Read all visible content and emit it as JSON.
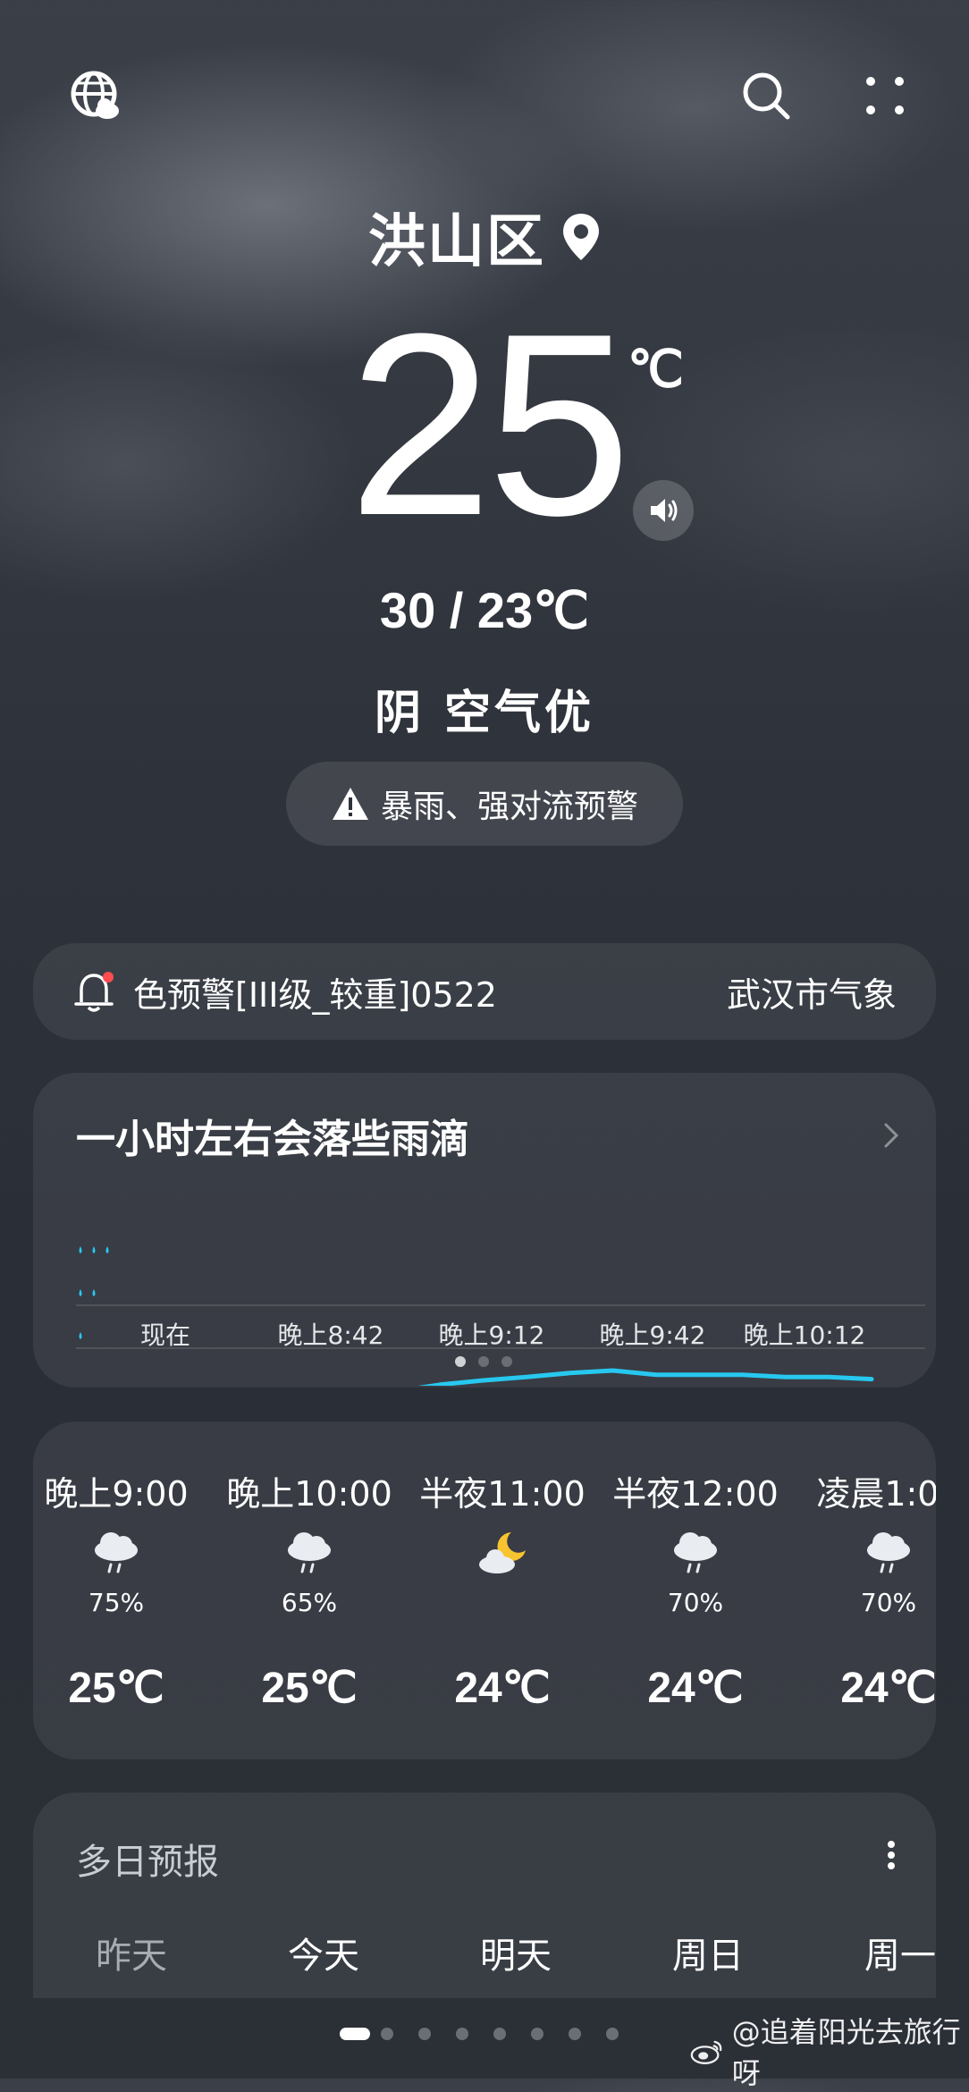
{
  "header": {
    "city": "洪山区",
    "temperature": "25",
    "unit": "℃",
    "hi_lo": "30 / 23℃",
    "condition": "阴  空气优",
    "alert": "暴雨、强对流预警"
  },
  "warning_banner": {
    "text": "色预警[III级_较重]0522",
    "source": "武汉市气象"
  },
  "rain": {
    "title": "一小时左右会落些雨滴",
    "time_labels": [
      "现在",
      "晚上8:42",
      "晚上9:12",
      "晚上9:42",
      "晚上10:12"
    ],
    "page_dots": 3,
    "active_dot": 0
  },
  "hourly": [
    {
      "time": "晚上9:00",
      "icon": "rain-cloud-icon",
      "pct": "75%",
      "temp": "25℃"
    },
    {
      "time": "晚上10:00",
      "icon": "rain-cloud-icon",
      "pct": "65%",
      "temp": "25℃"
    },
    {
      "time": "半夜11:00",
      "icon": "moon-cloud-icon",
      "pct": "",
      "temp": "24℃"
    },
    {
      "time": "半夜12:00",
      "icon": "rain-cloud-icon",
      "pct": "70%",
      "temp": "24℃"
    },
    {
      "time": "凌晨1:00",
      "icon": "rain-cloud-icon",
      "pct": "70%",
      "temp": "24℃"
    }
  ],
  "daily": {
    "title": "多日预报",
    "days": [
      "昨天",
      "今天",
      "明天",
      "周日",
      "周一"
    ]
  },
  "pager": {
    "count": 8,
    "active": 0
  },
  "watermark": "@追着阳光去旅行呀",
  "colors": {
    "accent": "#27c8ef",
    "warning_dot": "#ff4d4f"
  },
  "chart_data": {
    "type": "line",
    "title": "一小时左右会落些雨滴",
    "xlabel": "",
    "ylabel": "",
    "categories": [
      "现在",
      "晚上8:42",
      "晚上9:12",
      "晚上9:42",
      "晚上10:12"
    ],
    "ylim": [
      0,
      3
    ],
    "series": [
      {
        "values": [
          0.0,
          0.0,
          0.0,
          0.0,
          0.0,
          0.0,
          0.0,
          0.15,
          0.25,
          0.33,
          0.42,
          0.48,
          0.38,
          0.38,
          0.38,
          0.33,
          0.33,
          0.28
        ]
      }
    ]
  }
}
